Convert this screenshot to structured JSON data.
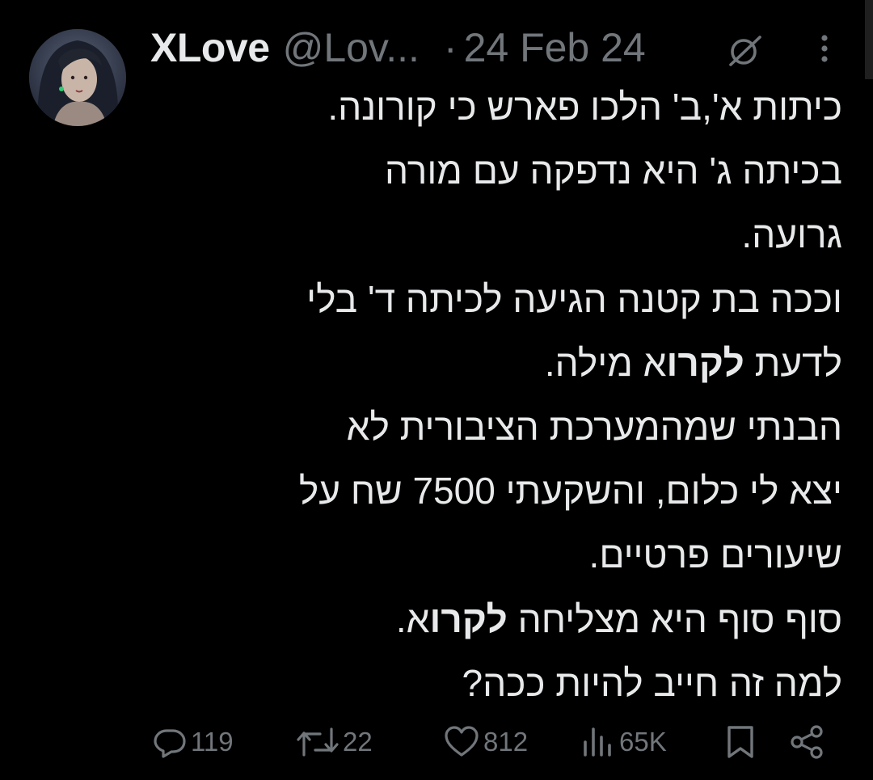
{
  "tweet": {
    "author_name": "XLove",
    "handle": "@Lov...",
    "separator": "·",
    "date": "24 Feb 24",
    "lines": [
      {
        "text": "כיתות א',ב' הלכו פארש כי קורונה."
      },
      {
        "text": "בכיתה ג' היא נדפקה עם מורה"
      },
      {
        "text": "גרועה."
      },
      {
        "text": "וככה בת קטנה הגיעה לכיתה ד' בלי"
      },
      {
        "pre": "לדעת ",
        "bold": "לקרו",
        "post": "א מילה."
      },
      {
        "text": "הבנתי שמהמערכת הציבורית לא"
      },
      {
        "text": "יצא לי כלום, והשקעתי 7500 שח על"
      },
      {
        "text": "שיעורים פרטיים."
      },
      {
        "pre": "סוף סוף היא מצליחה ",
        "bold": "לקרו",
        "post": "א."
      },
      {
        "text": "למה זה חייב להיות ככה?"
      }
    ]
  },
  "actions": {
    "replies": "119",
    "reposts": "22",
    "likes": "812",
    "views": "65K"
  },
  "icons": {
    "edited": "edited-slash-icon",
    "more": "more-vertical-icon",
    "reply": "reply-bubble-icon",
    "repost": "repost-arrows-icon",
    "like": "heart-icon",
    "views": "views-bars-icon",
    "bookmark": "bookmark-icon",
    "share": "share-icon"
  },
  "colors": {
    "background": "#000000",
    "text": "#e7e9ea",
    "muted": "#71767b"
  }
}
